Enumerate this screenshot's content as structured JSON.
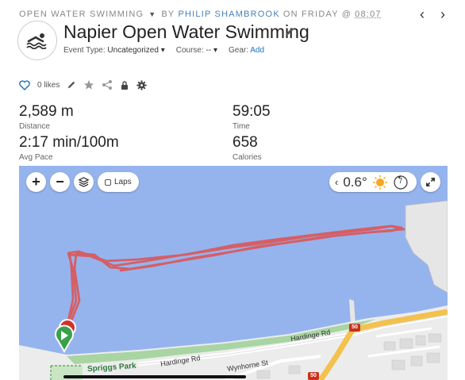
{
  "header": {
    "activity_type": "OPEN WATER SWIMMING",
    "by": "BY",
    "user": "PHILIP SHAMBROOK",
    "on": "ON FRIDAY @",
    "time": "08:07",
    "title": "Napier Open Water Swimming",
    "event_type_label": "Event Type:",
    "event_type_value": "Uncategorized",
    "course_label": "Course:",
    "course_value": "--",
    "gear_label": "Gear:",
    "gear_add": "Add"
  },
  "social": {
    "likes": "0 likes"
  },
  "stats": {
    "distance": {
      "value": "2,589 m",
      "label": "Distance"
    },
    "time": {
      "value": "59:05",
      "label": "Time"
    },
    "pace": {
      "value": "2:17 min/100m",
      "label": "Avg Pace"
    },
    "calories": {
      "value": "658",
      "label": "Calories"
    }
  },
  "map": {
    "laps_label": "Laps",
    "temperature": "0.6°",
    "weather_icon": "sun-icon",
    "wind_value": "7",
    "streets": {
      "hardinge_rd_1": "Hardinge Rd",
      "hardinge_rd_2": "Hardinge Rd",
      "wynhorne_st": "Wynhorne St"
    },
    "park": "Spriggs Park",
    "route_shields": [
      "50",
      "50"
    ],
    "colors": {
      "water": "#95b4ee",
      "route": "#d95b5f",
      "land": "#ececec",
      "road": "#f2c14e"
    }
  }
}
